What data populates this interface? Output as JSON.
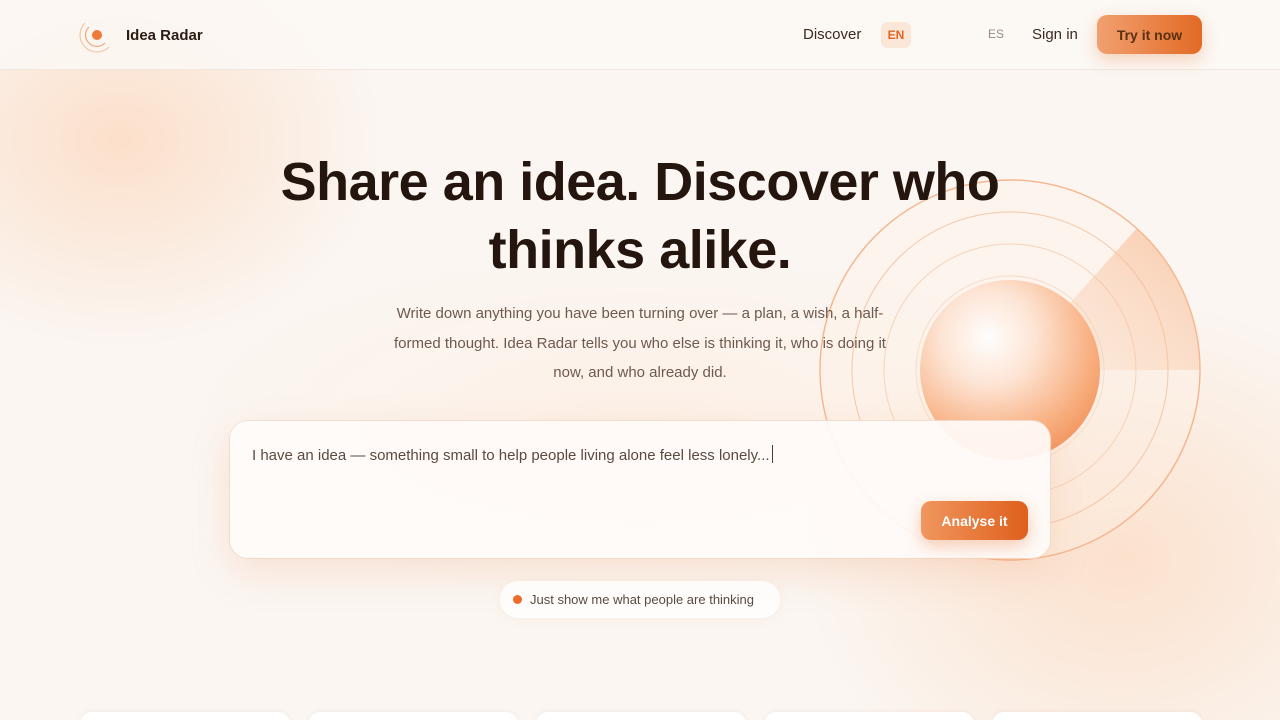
{
  "header": {
    "brand": "Idea Radar",
    "nav": {
      "discover": "Discover",
      "lang_en": "EN",
      "lang_es": "ES",
      "sign_in": "Sign in",
      "cta": "Try it now"
    }
  },
  "hero": {
    "title_line1": "Share an idea. Discover who",
    "title_line2": "thinks alike.",
    "sub_line1": "Write down anything you have been turning over — a plan, a wish, a half-",
    "sub_line2": "formed thought. Idea Radar tells you who else is thinking it, who is doing it",
    "sub_line3": "now, and who already did."
  },
  "idea_box": {
    "value": "I have an idea — something small to help people living alone feel less lonely...",
    "submit_label": "Analyse it"
  },
  "browse": {
    "label": "Just show me what people are thinking"
  },
  "colors": {
    "accent": "#e26a25",
    "accent_light": "#f1a070",
    "background": "#fbf6f2",
    "text": "#24160e"
  },
  "icons": {
    "logo": "radar-signal-icon",
    "browse_dot": "dot-icon"
  }
}
